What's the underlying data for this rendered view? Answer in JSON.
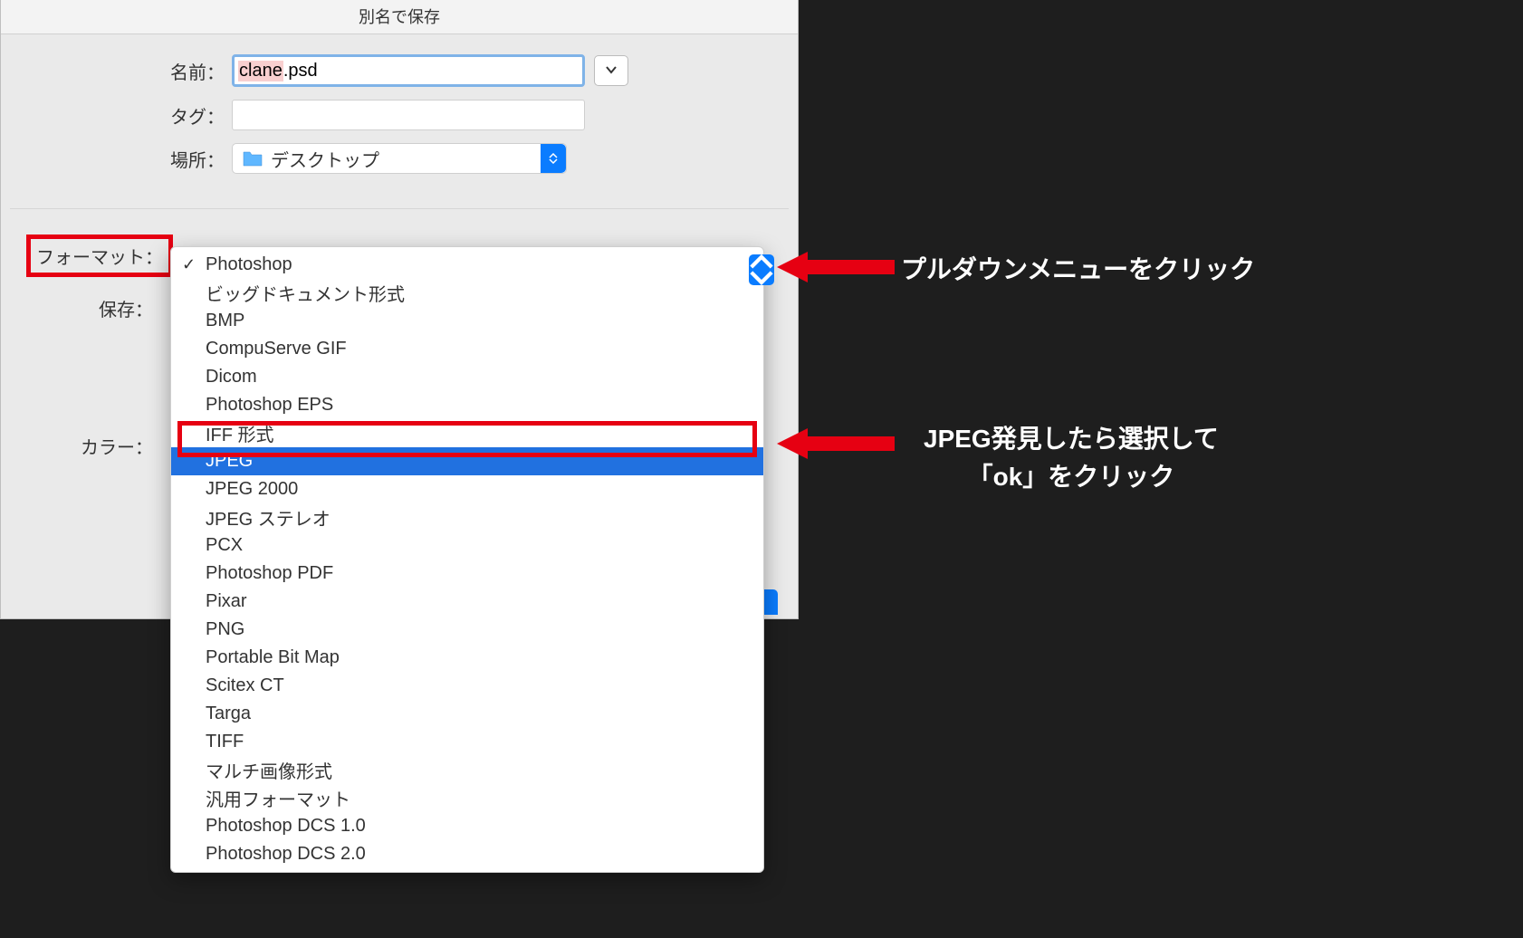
{
  "dialog": {
    "title": "別名で保存",
    "fields": {
      "name_label": "名前：",
      "name_value_highlight": "clane",
      "name_value_rest": ".psd",
      "tags_label": "タグ：",
      "location_label": "場所：",
      "location_value": "デスクトップ"
    },
    "lower": {
      "format_label": "フォーマット：",
      "save_label": "保存：",
      "color_label": "カラー："
    },
    "format_options": [
      {
        "label": "Photoshop",
        "checked": true
      },
      {
        "label": "ビッグドキュメント形式"
      },
      {
        "label": "BMP"
      },
      {
        "label": "CompuServe GIF"
      },
      {
        "label": "Dicom"
      },
      {
        "label": "Photoshop EPS"
      },
      {
        "label": "IFF 形式"
      },
      {
        "label": "JPEG",
        "highlighted": true
      },
      {
        "label": "JPEG 2000"
      },
      {
        "label": "JPEG ステレオ"
      },
      {
        "label": "PCX"
      },
      {
        "label": "Photoshop PDF"
      },
      {
        "label": "Pixar"
      },
      {
        "label": "PNG"
      },
      {
        "label": "Portable Bit Map"
      },
      {
        "label": "Scitex CT"
      },
      {
        "label": "Targa"
      },
      {
        "label": "TIFF"
      },
      {
        "label": "マルチ画像形式"
      },
      {
        "label": "汎用フォーマット"
      },
      {
        "label": "Photoshop DCS 1.0"
      },
      {
        "label": "Photoshop DCS 2.0"
      }
    ]
  },
  "annotations": {
    "caption1": "プルダウンメニューをクリック",
    "caption2_line1": "JPEG発見したら選択して",
    "caption2_line2": "「ok」をクリック"
  },
  "colors": {
    "red": "#e60012",
    "blue": "#0a7cff",
    "select_blue": "#2171e0"
  }
}
